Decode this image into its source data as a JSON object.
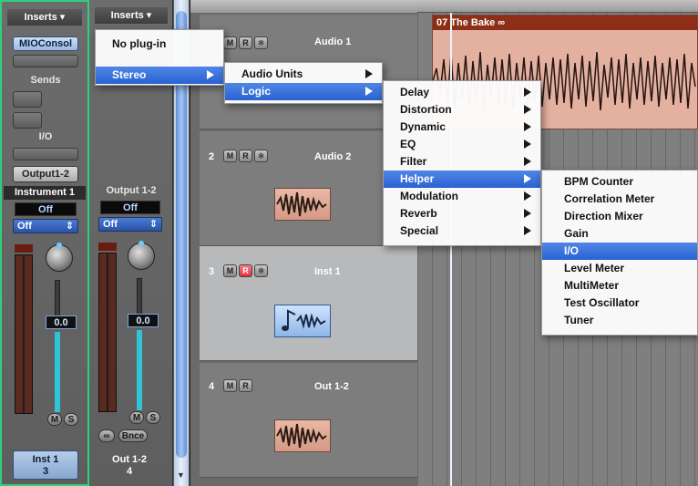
{
  "mixer": {
    "strip1": {
      "inserts_label": "Inserts",
      "insert_plugin": "MIOConsol",
      "sends_label": "Sends",
      "io_label": "I/O",
      "output": "Output1-2",
      "name_label": "Instrument 1",
      "lcd": "Off",
      "automation": "Off",
      "volume": "0.0",
      "mute": "M",
      "solo": "S",
      "bottom_name": "Inst 1",
      "bottom_num": "3"
    },
    "strip2": {
      "inserts_label": "Inserts",
      "name_label": "Output 1-2",
      "lcd": "Off",
      "automation": "Off",
      "volume": "0.0",
      "mute": "M",
      "solo": "S",
      "link_icon": "link-icon",
      "bounce": "Bnce",
      "bottom_name": "Out 1-2",
      "bottom_num": "4"
    }
  },
  "tracks": [
    {
      "num": "",
      "name": "Audio 1",
      "mute": "M",
      "rec": "R",
      "freeze": "❄"
    },
    {
      "num": "2",
      "name": "Audio 2",
      "mute": "M",
      "rec": "R",
      "freeze": "❄"
    },
    {
      "num": "3",
      "name": "Inst 1",
      "mute": "M",
      "rec": "R",
      "freeze": "❄"
    },
    {
      "num": "4",
      "name": "Out 1-2",
      "mute": "M",
      "rec": "R"
    }
  ],
  "region": {
    "title": "07 The Bake",
    "loop_icon": "loop-icon"
  },
  "menus": {
    "level1": {
      "items": [
        "No plug-in",
        "Stereo"
      ],
      "highlighted": "Stereo"
    },
    "level2": {
      "items": [
        "Audio Units",
        "Logic"
      ],
      "highlighted": "Logic"
    },
    "level3": {
      "items": [
        "Delay",
        "Distortion",
        "Dynamic",
        "EQ",
        "Filter",
        "Helper",
        "Modulation",
        "Reverb",
        "Special"
      ],
      "highlighted": "Helper"
    },
    "level4": {
      "items": [
        "BPM Counter",
        "Correlation Meter",
        "Direction Mixer",
        "Gain",
        "I/O",
        "Level Meter",
        "MultiMeter",
        "Test Oscillator",
        "Tuner"
      ],
      "highlighted": "I/O"
    }
  },
  "colors": {
    "accent": "#2a62d3",
    "strip_selected_border": "#2fd07a",
    "record": "#e0313d",
    "region": "#e4b0a0"
  }
}
